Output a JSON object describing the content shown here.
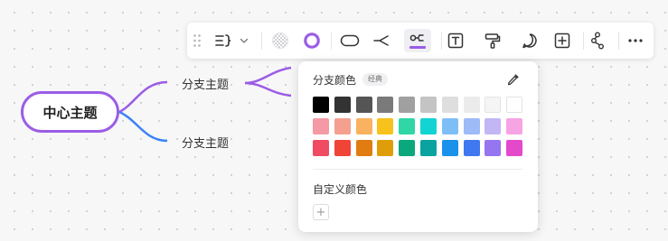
{
  "mindmap": {
    "center_label": "中心主题",
    "branch_top_label": "分支主题",
    "branch_bottom_label": "分支主题",
    "branch_top_color": "#9b5de5",
    "branch_bottom_color": "#3b82f6"
  },
  "toolbar": {
    "items": [
      "drag-handle-icon",
      "structure-icon",
      "chevron-down-icon",
      "fill-color-icon",
      "border-color-icon",
      "shape-icon",
      "branch-style-icon",
      "branch-color-icon",
      "text-icon",
      "format-painter-icon",
      "comment-icon",
      "insert-icon",
      "relationship-icon",
      "more-icon"
    ],
    "active_item": "branch-color-icon",
    "accent_color": "#9b5de5"
  },
  "palette": {
    "title": "分支颜色",
    "badge": "经典",
    "custom_label": "自定义颜色",
    "add_symbol": "+",
    "rows": [
      [
        "#000000",
        "#333333",
        "#555555",
        "#7a7a7a",
        "#a0a0a0",
        "#c4c4c4",
        "#dedede",
        "#ebebeb",
        "#f5f5f5",
        "#ffffff"
      ],
      [
        "#f59aa5",
        "#f5a08f",
        "#f9b360",
        "#f7c21c",
        "#30d6a6",
        "#12d4d2",
        "#7ebef7",
        "#9ebaf7",
        "#c3b6f5",
        "#f6a4e3"
      ],
      [
        "#f04b62",
        "#f04436",
        "#e07c12",
        "#e09d0a",
        "#0aa87c",
        "#0aa39f",
        "#1a91ea",
        "#3f78f0",
        "#9675f0",
        "#e549cb"
      ]
    ]
  }
}
